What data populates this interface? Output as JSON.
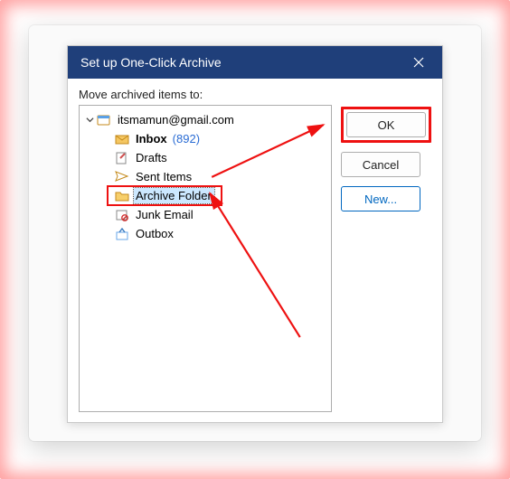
{
  "dialog": {
    "title": "Set up One-Click Archive",
    "prompt": "Move archived items to:"
  },
  "buttons": {
    "ok": "OK",
    "cancel": "Cancel",
    "new": "New..."
  },
  "tree": {
    "root": {
      "label": "itsmamun@gmail.com",
      "expanded": true,
      "icon": "mailbox-icon"
    },
    "items": [
      {
        "label": "Inbox",
        "count": "(892)",
        "bold": true,
        "icon": "inbox-icon"
      },
      {
        "label": "Drafts",
        "icon": "drafts-icon"
      },
      {
        "label": "Sent Items",
        "icon": "sent-icon"
      },
      {
        "label": "Archive Folder",
        "icon": "folder-icon",
        "selected": true
      },
      {
        "label": "Junk Email",
        "icon": "junk-icon"
      },
      {
        "label": "Outbox",
        "icon": "outbox-icon"
      }
    ]
  },
  "colors": {
    "titlebar": "#1f3f7a",
    "highlight": "#e11",
    "selection": "#cce8ff",
    "link": "#2a6cd4"
  }
}
